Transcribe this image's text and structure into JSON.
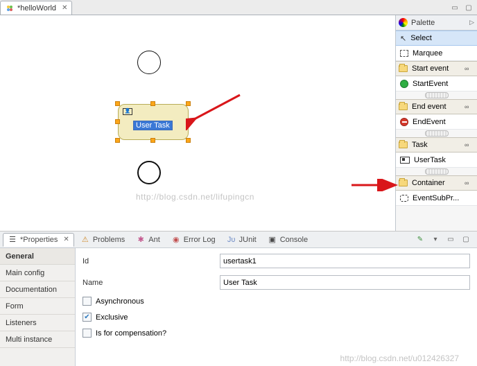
{
  "editor_tab": {
    "title": "*helloWorld"
  },
  "canvas": {
    "user_task_label": "User Task",
    "watermark": "http://blog.csdn.net/lifupingcn"
  },
  "palette": {
    "title": "Palette",
    "select": "Select",
    "marquee": "Marquee",
    "cat_start": "Start event",
    "start_event": "StartEvent",
    "cat_end": "End event",
    "end_event": "EndEvent",
    "cat_task": "Task",
    "user_task": "UserTask",
    "cat_container": "Container",
    "event_subprocess": "EventSubPr..."
  },
  "views": {
    "properties": "*Properties",
    "problems": "Problems",
    "ant": "Ant",
    "error_log": "Error Log",
    "junit": "JUnit",
    "console": "Console"
  },
  "props": {
    "cats": {
      "general": "General",
      "main_config": "Main config",
      "documentation": "Documentation",
      "form": "Form",
      "listeners": "Listeners",
      "multi_instance": "Multi instance"
    },
    "fields": {
      "id_label": "Id",
      "id_value": "usertask1",
      "name_label": "Name",
      "name_value": "User Task",
      "asynchronous": "Asynchronous",
      "exclusive": "Exclusive",
      "compensation": "Is for compensation?"
    }
  },
  "watermark2": "http://blog.csdn.net/u012426327"
}
